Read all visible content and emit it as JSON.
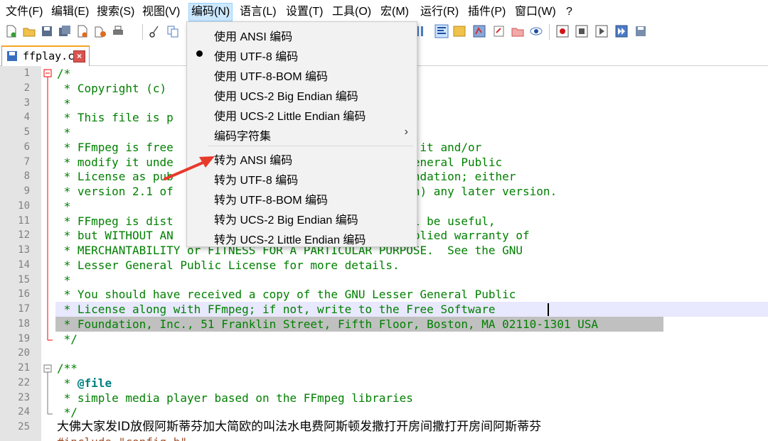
{
  "menubar": {
    "items": [
      "文件(F)",
      "编辑(E)",
      "搜索(S)",
      "视图(V)",
      "编码(N)",
      "语言(L)",
      "设置(T)",
      "工具(O)",
      "宏(M)",
      "运行(R)",
      "插件(P)",
      "窗口(W)",
      "?"
    ],
    "active_index": 4
  },
  "tab": {
    "label": "ffplay.c",
    "close_label": "×"
  },
  "encoding_menu": {
    "items": [
      {
        "label": "使用 ANSI 编码"
      },
      {
        "label": "使用 UTF-8 编码",
        "checked": true
      },
      {
        "label": "使用 UTF-8-BOM 编码"
      },
      {
        "label": "使用 UCS-2 Big Endian 编码"
      },
      {
        "label": "使用 UCS-2 Little Endian 编码"
      },
      {
        "label": "编码字符集",
        "submenu_glyph": "›"
      },
      {
        "label": "转为 ANSI 编码"
      },
      {
        "label": "转为 UTF-8 编码"
      },
      {
        "label": "转为 UTF-8-BOM 编码"
      },
      {
        "label": "转为 UCS-2 Big Endian 编码"
      },
      {
        "label": "转为 UCS-2 Little Endian 编码"
      }
    ]
  },
  "editor": {
    "line_numbers": [
      "1",
      "2",
      "3",
      "4",
      "5",
      "6",
      "7",
      "8",
      "9",
      "10",
      "11",
      "12",
      "13",
      "14",
      "15",
      "16",
      "17",
      "18",
      "19",
      "20",
      "21",
      "22",
      "23",
      "24",
      "25"
    ],
    "lines": [
      "/*",
      " * Copyright (c)",
      " *",
      " * This file is p",
      " *",
      " * FFmpeg is free                                  e it and/or",
      " * modify it unde                                  General Public",
      " * License as pub                                  undation; either",
      " * version 2.1 of                                  on) any later version.",
      " *",
      " * FFmpeg is dist                                  ll be useful,",
      " * but WITHOUT AN                                  mplied warranty of",
      " * MERCHANTABILITY or FITNESS FOR A PARTICULAR PURPOSE.  See the GNU",
      " * Lesser General Public License for more details.",
      " *",
      " * You should have received a copy of the GNU Lesser General Public",
      " * License along with FFmpeg; if not, write to the Free Software",
      " * Foundation, Inc., 51 Franklin Street, Fifth Floor, Boston, MA 02110-1301 USA",
      " */",
      "",
      "/**",
      " * ",
      " * simple media player based on the FFmpeg libraries",
      " */",
      "大佛大家发ID放假阿斯蒂芬加大简欧的叫法水电费阿斯顿发撒打开房间撒打开房间阿斯蒂芬"
    ],
    "file_tag": "@file",
    "next_line_partial": "#include \"config.h\""
  },
  "colors": {
    "comment": "#008000",
    "gutter": "#e4e4e4",
    "menu_active": "#cce8ff",
    "dropdown_bg": "#f2f2f2",
    "arrow": "#e8392b",
    "fold_line": "#ff0000"
  }
}
